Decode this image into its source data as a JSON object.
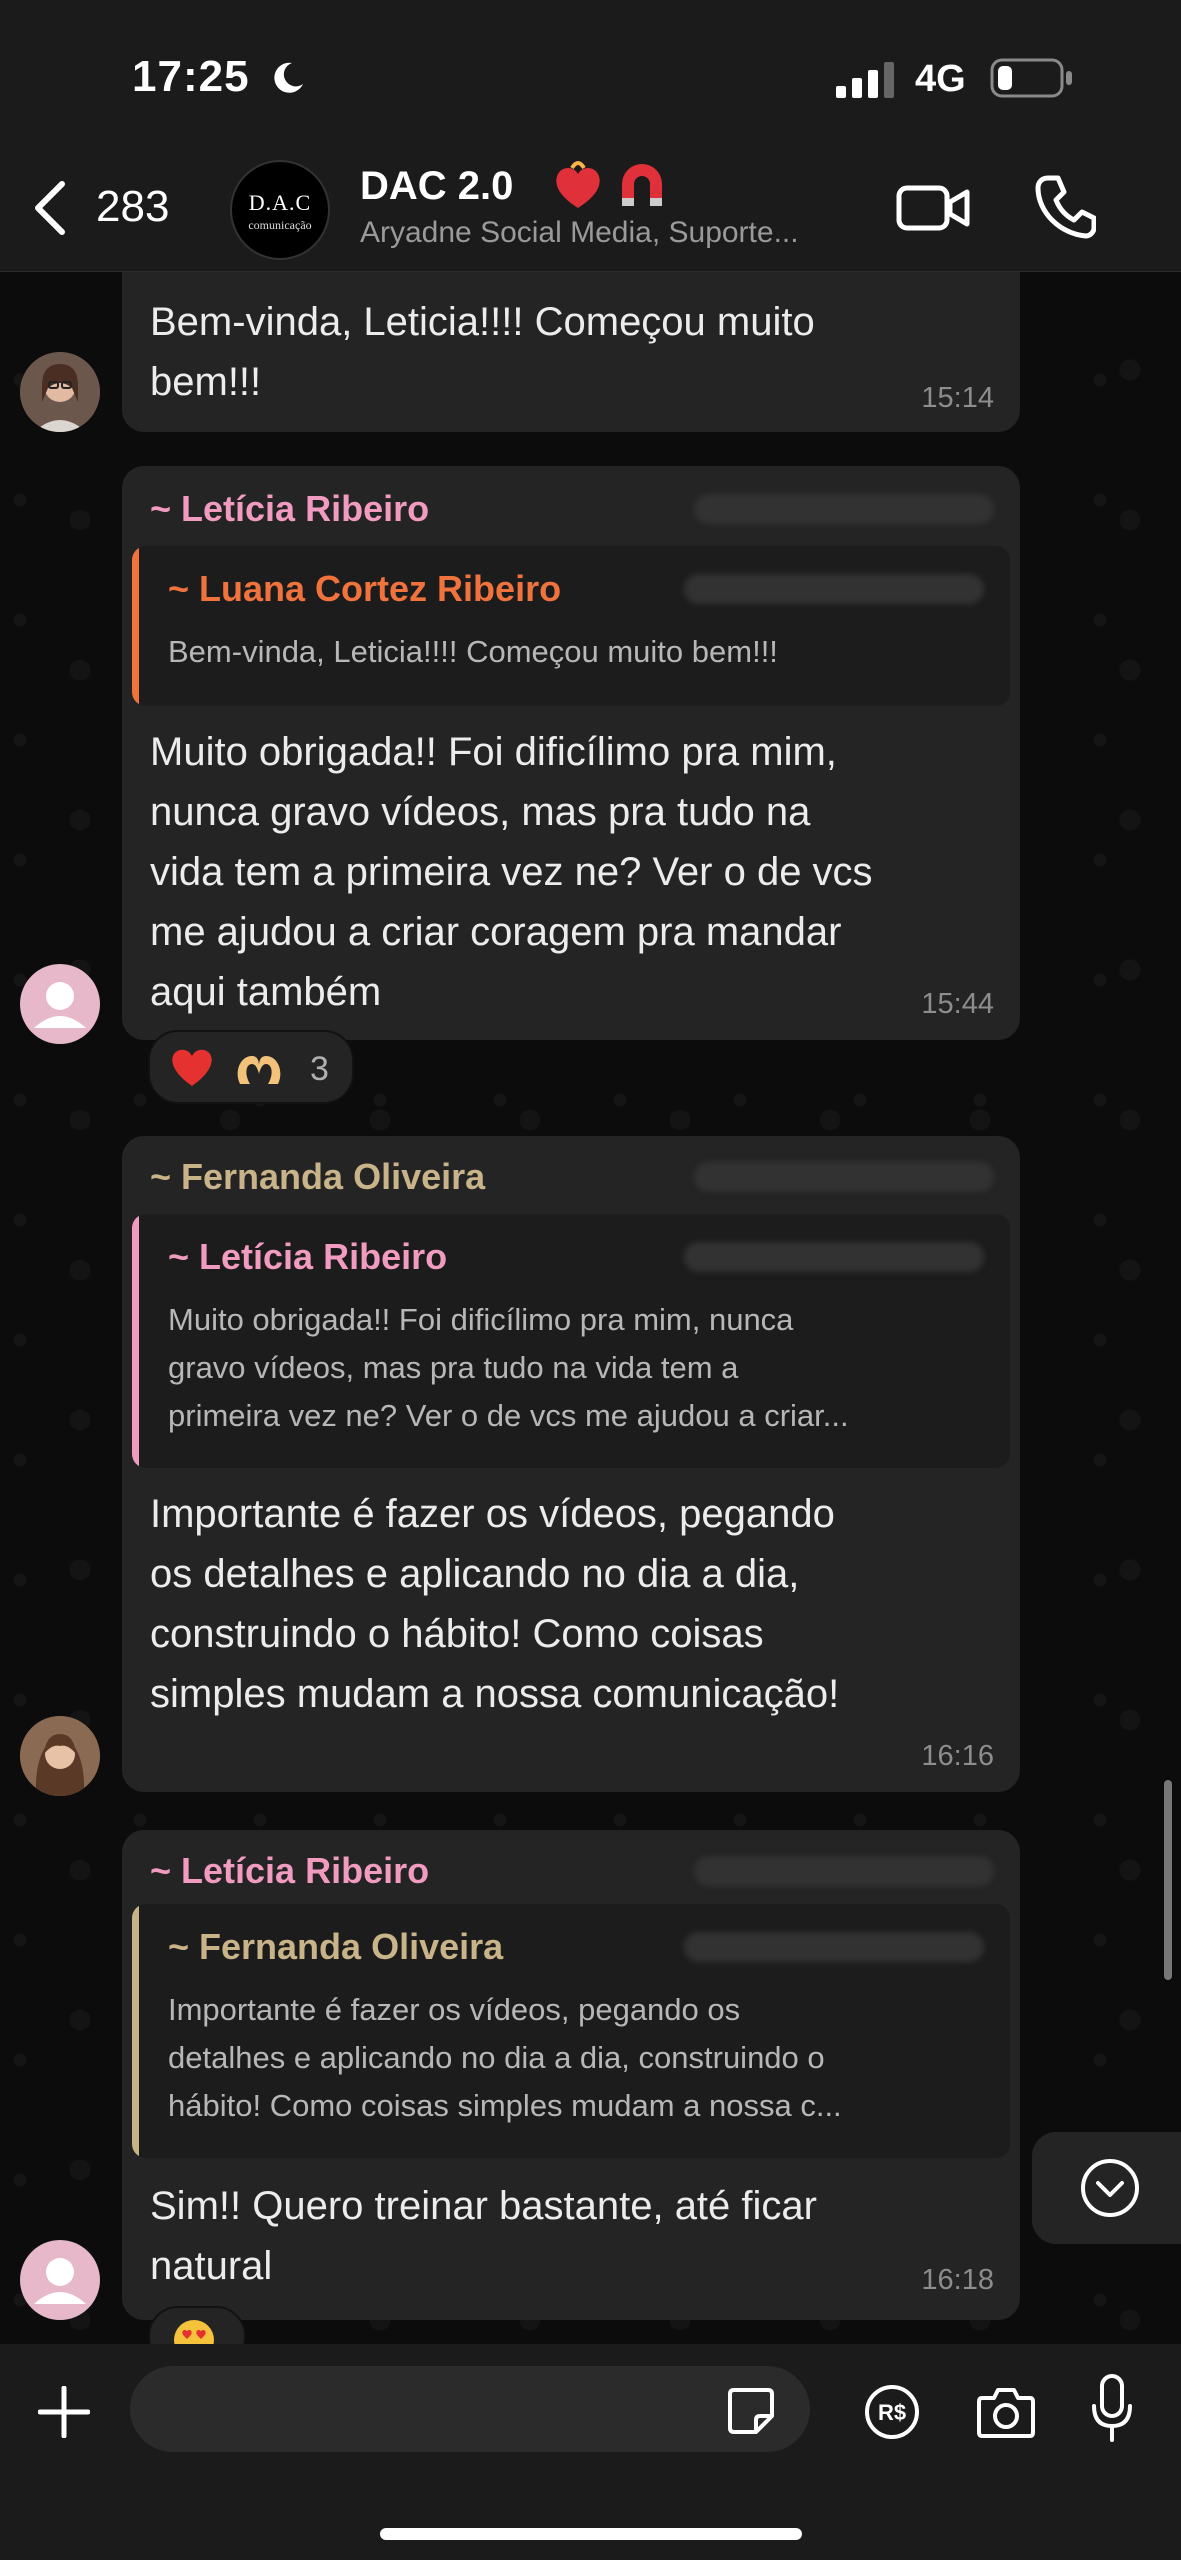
{
  "status_bar": {
    "time": "17:25",
    "network": "4G"
  },
  "header": {
    "back_count": "283",
    "avatar_logo_line1": "D.A.C",
    "avatar_logo_line2": "comunicação",
    "title": "DAC  2.0",
    "subtitle": "Aryadne Social Media, Suporte..."
  },
  "messages": [
    {
      "text": "Bem-vinda, Leticia!!!! Começou muito\nbem!!!",
      "time": "15:14"
    },
    {
      "sender": "~ Letícia Ribeiro",
      "sender_color": "#f29bc0",
      "quote": {
        "sender": "~ Luana Cortez Ribeiro",
        "sender_color": "#f0733d",
        "text": "Bem-vinda, Leticia!!!! Começou muito bem!!!"
      },
      "text": "Muito obrigada!! Foi dificílimo pra mim,\nnunca gravo vídeos, mas pra tudo na\nvida tem a primeira vez ne? Ver o de vcs\nme ajudou a criar coragem pra mandar\naqui também",
      "time": "15:44",
      "reactions": {
        "count": "3"
      }
    },
    {
      "sender": "~ Fernanda Oliveira",
      "sender_color": "#c9b48a",
      "quote": {
        "sender": "~ Letícia Ribeiro",
        "sender_color": "#f29bc0",
        "text": "Muito obrigada!! Foi dificílimo pra mim, nunca\ngravo vídeos, mas pra tudo na vida tem a\nprimeira vez ne? Ver o de vcs me ajudou a criar..."
      },
      "text": "Importante é fazer os vídeos, pegando\nos detalhes e aplicando no dia a dia,\nconstruindo o hábito! Como coisas\nsimples mudam a nossa comunicação!",
      "time": "16:16"
    },
    {
      "sender": "~ Letícia Ribeiro",
      "sender_color": "#f29bc0",
      "quote": {
        "sender": "~ Fernanda Oliveira",
        "sender_color": "#c9b48a",
        "text": "Importante é fazer os vídeos, pegando os\ndetalhes e aplicando no dia a dia, construindo o\nhábito! Como coisas simples mudam a nossa c..."
      },
      "text": "Sim!! Quero treinar bastante, até ficar\nnatural",
      "time": "16:18"
    }
  ],
  "footer": {
    "input_placeholder": ""
  },
  "icons": {
    "back": "chevron-left-icon",
    "video": "video-call-icon",
    "phone": "phone-call-icon",
    "plus": "plus-icon",
    "sticker": "sticker-icon",
    "payment": "payment-icon",
    "camera": "camera-icon",
    "mic": "microphone-icon",
    "scroll_down": "chevron-down-icon"
  }
}
